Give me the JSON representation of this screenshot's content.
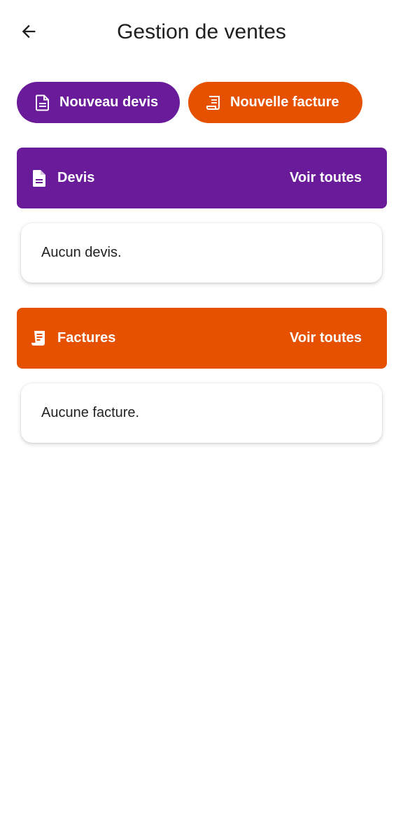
{
  "appbar": {
    "title": "Gestion de ventes"
  },
  "actions": {
    "new_quote_label": "Nouveau devis",
    "new_invoice_label": "Nouvelle facture"
  },
  "sections": {
    "quotes": {
      "title": "Devis",
      "see_all": "Voir toutes",
      "empty_text": "Aucun devis."
    },
    "invoices": {
      "title": "Factures",
      "see_all": "Voir toutes",
      "empty_text": "Aucune facture."
    }
  },
  "colors": {
    "purple": "#6a1b9a",
    "orange": "#e65100",
    "text_dark": "#1f1f1f"
  },
  "icons": {
    "back": "arrow-back-icon",
    "quote": "document-icon",
    "invoice": "receipt-icon"
  }
}
